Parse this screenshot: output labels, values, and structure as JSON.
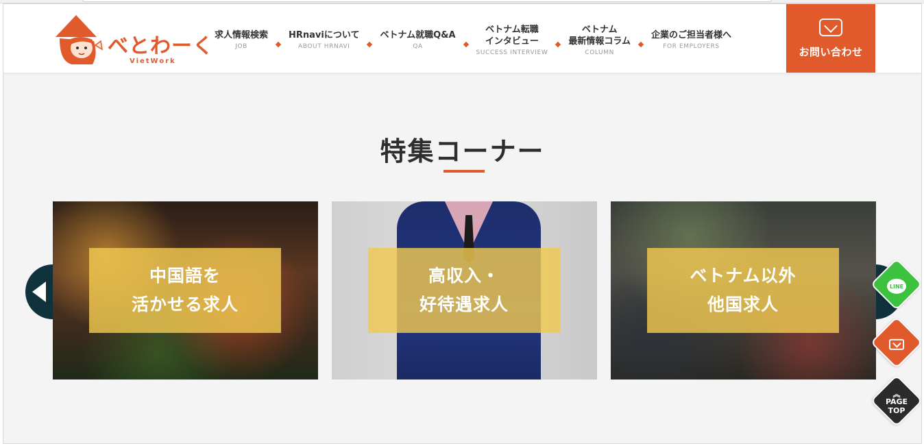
{
  "logo": {
    "text": "べとわーく",
    "sub": "VietWork"
  },
  "nav": {
    "items": [
      {
        "main": "求人情報検索",
        "sub": "JOB"
      },
      {
        "main": "HRnaviについて",
        "sub": "ABOUT HRNAVI"
      },
      {
        "main": "ベトナム就職Q&A",
        "sub": "QA"
      },
      {
        "main_line1": "ベトナム転職",
        "main_line2": "インタビュー",
        "sub": "SUCCESS INTERVIEW"
      },
      {
        "main_line1": "ベトナム",
        "main_line2": "最新情報コラム",
        "sub": "COLUMN"
      },
      {
        "main": "企業のご担当者様へ",
        "sub": "FOR EMPLOYERS"
      }
    ]
  },
  "contact": {
    "label": "お問い合わせ"
  },
  "section": {
    "title": "特集コーナー"
  },
  "cards": [
    {
      "line1": "中国語を",
      "line2": "活かせる求人"
    },
    {
      "line1": "高収入・",
      "line2": "好待遇求人"
    },
    {
      "line1": "ベトナム以外",
      "line2": "他国求人"
    }
  ],
  "floating": {
    "line_label": "LINE",
    "page_top_line1": "PAGE",
    "page_top_line2": "TOP"
  },
  "colors": {
    "brand": "#e05a2b",
    "line_green": "#3cc23f",
    "card_overlay": "#f0c850",
    "arrow_bg": "#10323d"
  }
}
